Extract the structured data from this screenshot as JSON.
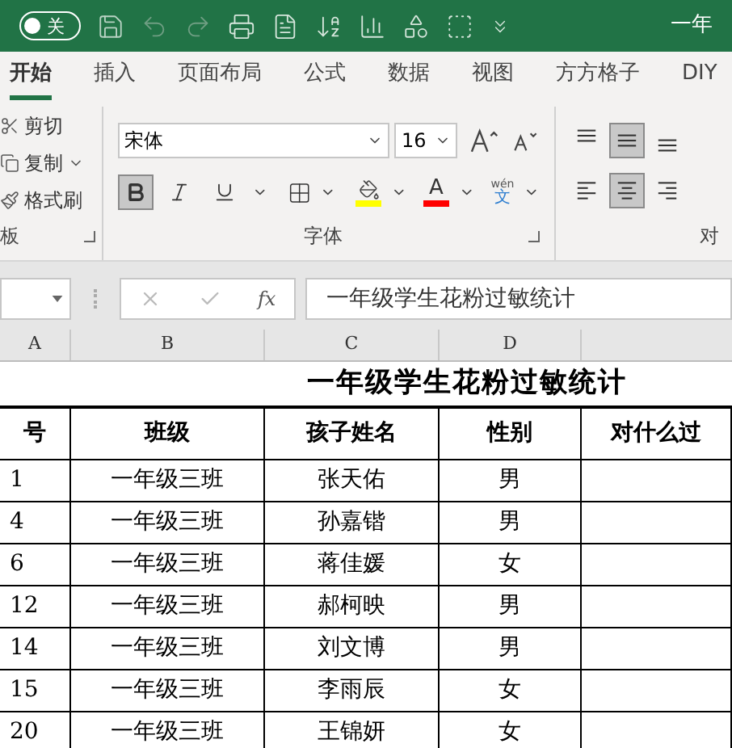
{
  "title_bar": {
    "autosave": {
      "label": "关",
      "on": false
    },
    "title": "一年"
  },
  "tabs": [
    {
      "label": "开始",
      "selected": true
    },
    {
      "label": "插入",
      "selected": false
    },
    {
      "label": "页面布局",
      "selected": false
    },
    {
      "label": "公式",
      "selected": false
    },
    {
      "label": "数据",
      "selected": false
    },
    {
      "label": "视图",
      "selected": false
    },
    {
      "label": "方方格子",
      "selected": false
    },
    {
      "label": "DIY",
      "selected": false
    }
  ],
  "clipboard": {
    "items": [
      {
        "kind": "cut",
        "label": "剪切",
        "has_menu": false
      },
      {
        "kind": "copy",
        "label": "复制",
        "has_menu": true
      },
      {
        "kind": "painter",
        "label": "格式刷",
        "has_menu": false
      }
    ],
    "group_label": "板"
  },
  "font": {
    "font_name": "宋体",
    "font_size": "16",
    "toggles": [
      {
        "kind": "bold",
        "selected": true
      },
      {
        "kind": "italic",
        "selected": false
      },
      {
        "kind": "underline",
        "selected": false
      }
    ],
    "color_letter": "A",
    "phonetic_top": "wén",
    "phonetic_bottom": "文",
    "group_label": "字体"
  },
  "alignment": {
    "vertical": [
      {
        "selected": false
      },
      {
        "selected": true
      },
      {
        "selected": false
      }
    ],
    "horizontal": [
      {
        "selected": false
      },
      {
        "selected": true
      },
      {
        "selected": false
      }
    ],
    "group_label": "对"
  },
  "formula_bar": {
    "fx": "fx",
    "content": "一年级学生花粉过敏统计"
  },
  "sheet": {
    "columns": [
      "A",
      "B",
      "C",
      "D"
    ],
    "title": "一年级学生花粉过敏统计",
    "header": [
      "号",
      "班级",
      "孩子姓名",
      "性别",
      "对什么过"
    ],
    "rows": [
      [
        "1",
        "一年级三班",
        "张天佑",
        "男"
      ],
      [
        "4",
        "一年级三班",
        "孙嘉锴",
        "男"
      ],
      [
        "6",
        "一年级三班",
        "蒋佳媛",
        "女"
      ],
      [
        "12",
        "一年级三班",
        "郝柯映",
        "男"
      ],
      [
        "14",
        "一年级三班",
        "刘文博",
        "男"
      ],
      [
        "15",
        "一年级三班",
        "李雨辰",
        "女"
      ],
      [
        "20",
        "一年级三班",
        "王锦妍",
        "女"
      ]
    ]
  }
}
